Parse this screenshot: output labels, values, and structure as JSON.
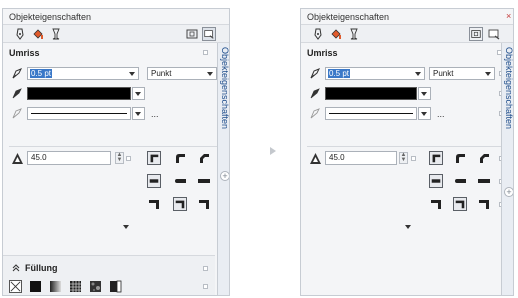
{
  "panel_title": "Objekteigenschaften",
  "close_glyph": "×",
  "outline": {
    "title": "Umriss",
    "width_value": "0.5 pt",
    "unit_value": "Punkt",
    "outline_color": "#000000",
    "more_button": "...",
    "angle_value": "45.0"
  },
  "fill": {
    "title": "Füllung"
  },
  "docker_tab_label": "Objekteigenschaften",
  "colors": {
    "selection": "#3a78c8",
    "tab_text": "#1f4e8c",
    "panel_bg": "#f4f5f7"
  }
}
